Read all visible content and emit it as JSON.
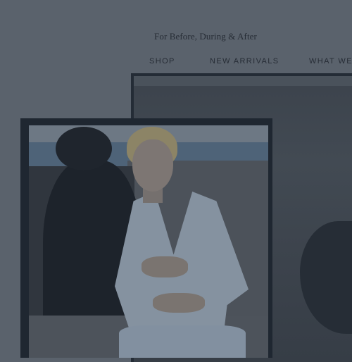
{
  "header": {
    "tagline": "For Before, During & After"
  },
  "nav": {
    "items": [
      {
        "label": "SHOP"
      },
      {
        "label": "NEW ARRIVALS"
      },
      {
        "label": "WHAT WE"
      }
    ]
  },
  "colors": {
    "overlay_background": "#5a626c",
    "text": "#262c35",
    "photo_frame": "#242c36"
  }
}
